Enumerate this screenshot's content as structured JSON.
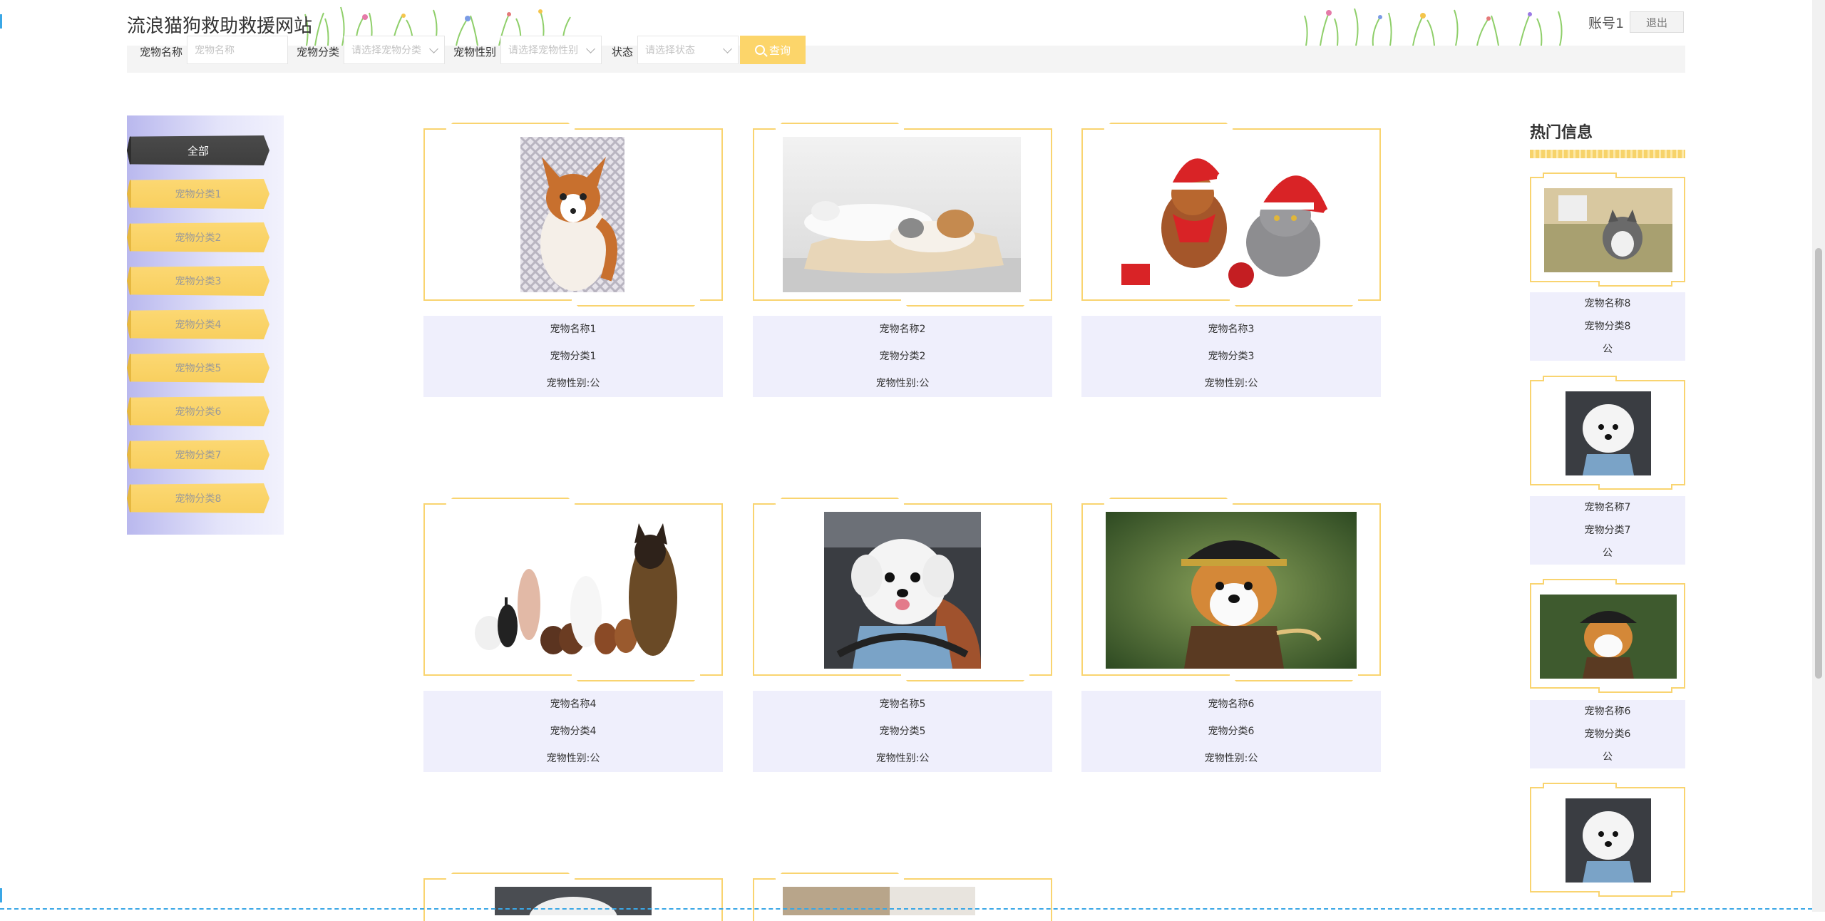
{
  "header": {
    "title": "流浪猫狗救助救援网站",
    "user": "账号1",
    "logout_label": "退出"
  },
  "search": {
    "name_label": "宠物名称",
    "name_placeholder": "宠物名称",
    "category_label": "宠物分类",
    "category_placeholder": "请选择宠物分类",
    "gender_label": "宠物性别",
    "gender_placeholder": "请选择宠物性别",
    "status_label": "状态",
    "status_placeholder": "请选择状态",
    "button_label": "查询"
  },
  "sidebar": {
    "items": [
      {
        "label": "全部"
      },
      {
        "label": "宠物分类1"
      },
      {
        "label": "宠物分类2"
      },
      {
        "label": "宠物分类3"
      },
      {
        "label": "宠物分类4"
      },
      {
        "label": "宠物分类5"
      },
      {
        "label": "宠物分类6"
      },
      {
        "label": "宠物分类7"
      },
      {
        "label": "宠物分类8"
      }
    ]
  },
  "pets": [
    {
      "name": "宠物名称1",
      "category": "宠物分类1",
      "gender": "宠物性别:公",
      "image": "chihuahua-photo"
    },
    {
      "name": "宠物名称2",
      "category": "宠物分类2",
      "gender": "宠物性别:公",
      "image": "sleeping-cat-dog-photo"
    },
    {
      "name": "宠物名称3",
      "category": "宠物分类3",
      "gender": "宠物性别:公",
      "image": "christmas-dog-cat-photo"
    },
    {
      "name": "宠物名称4",
      "category": "宠物分类4",
      "gender": "宠物性别:公",
      "image": "pet-group-photo"
    },
    {
      "name": "宠物名称5",
      "category": "宠物分类5",
      "gender": "宠物性别:公",
      "image": "poodle-in-car-photo"
    },
    {
      "name": "宠物名称6",
      "category": "宠物分类6",
      "gender": "宠物性别:公",
      "image": "pirate-corgi-photo"
    }
  ],
  "hot": {
    "title": "热门信息",
    "items": [
      {
        "name": "宠物名称8",
        "category": "宠物分类8",
        "gender": "公",
        "image": "husky-photo"
      },
      {
        "name": "宠物名称7",
        "category": "宠物分类7",
        "gender": "公",
        "image": "poodle-photo"
      },
      {
        "name": "宠物名称6",
        "category": "宠物分类6",
        "gender": "公",
        "image": "corgi-photo"
      }
    ]
  },
  "colors": {
    "accent": "#fcd56a",
    "card_border": "#f9d470",
    "info_bg": "#efeffc",
    "sidebar_active": "#444444"
  }
}
